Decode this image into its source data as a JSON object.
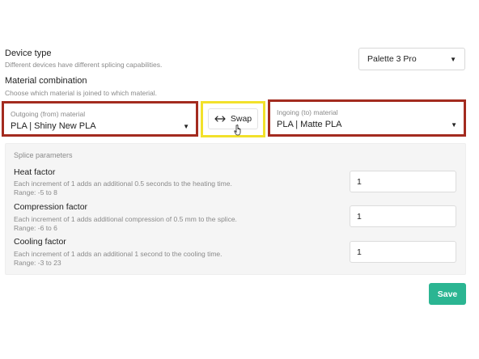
{
  "device": {
    "title": "Device type",
    "help": "Different devices have different splicing capabilities.",
    "selected": "Palette 3 Pro"
  },
  "material": {
    "title": "Material combination",
    "help": "Choose which material is joined to which material.",
    "outgoing": {
      "caption": "Outgoing (from) material",
      "value": "PLA | Shiny New PLA"
    },
    "swap_label": "Swap",
    "ingoing": {
      "caption": "Ingoing (to) material",
      "value": "PLA | Matte PLA"
    }
  },
  "splice": {
    "title": "Splice parameters",
    "params": [
      {
        "name": "Heat factor",
        "help": "Each increment of 1 adds an additional 0.5 seconds to the heating time.",
        "range": "Range: -5 to 8",
        "value": "1"
      },
      {
        "name": "Compression factor",
        "help": "Each increment of 1 adds additional compression of 0.5 mm to the splice.",
        "range": "Range: -6 to 6",
        "value": "1"
      },
      {
        "name": "Cooling factor",
        "help": "Each increment of 1 adds an additional 1 second to the cooling time.",
        "range": "Range: -3 to 23",
        "value": "1"
      }
    ]
  },
  "save_label": "Save",
  "colors": {
    "accent": "#2bb592",
    "highlight_red": "#a32b1f",
    "highlight_yellow": "#f2e12b"
  }
}
